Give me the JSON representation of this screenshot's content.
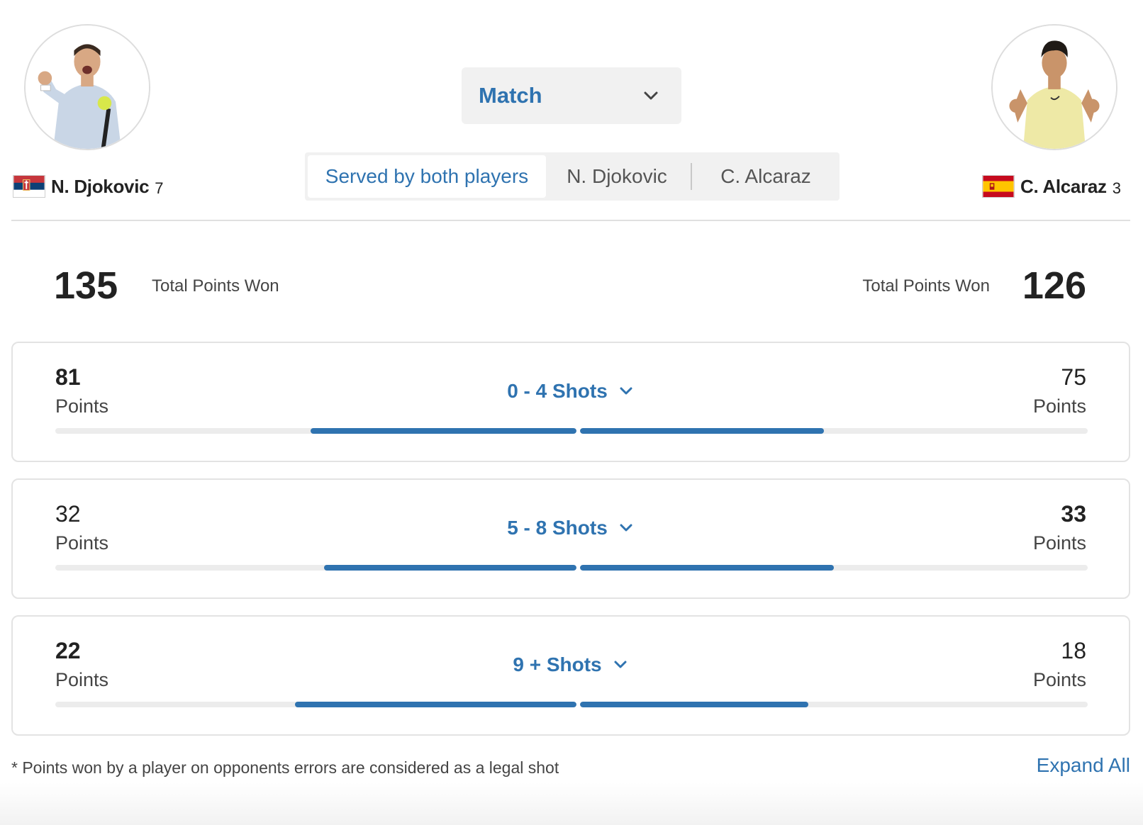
{
  "players": {
    "left": {
      "name": "N. Djokovic",
      "seed": "7",
      "flag": "serbia-flag",
      "total_points": "135",
      "total_label": "Total Points Won"
    },
    "right": {
      "name": "C. Alcaraz",
      "seed": "3",
      "flag": "spain-flag",
      "total_points": "126",
      "total_label": "Total Points Won"
    }
  },
  "period_select": {
    "value": "Match",
    "icon": "chevron-down-icon"
  },
  "serve_tabs": [
    {
      "label": "Served by both players",
      "active": true
    },
    {
      "label": "N. Djokovic",
      "active": false
    },
    {
      "label": "C. Alcaraz",
      "active": false
    }
  ],
  "rally_stats": [
    {
      "title": "0 - 4 Shots",
      "left": {
        "value": "81",
        "label": "Points",
        "bold": true,
        "bar_fraction": 0.51
      },
      "right": {
        "value": "75",
        "label": "Points",
        "bold": false,
        "bar_fraction": 0.48
      }
    },
    {
      "title": "5 - 8 Shots",
      "left": {
        "value": "32",
        "label": "Points",
        "bold": false,
        "bar_fraction": 0.485
      },
      "right": {
        "value": "33",
        "label": "Points",
        "bold": true,
        "bar_fraction": 0.5
      }
    },
    {
      "title": "9 + Shots",
      "left": {
        "value": "22",
        "label": "Points",
        "bold": true,
        "bar_fraction": 0.54
      },
      "right": {
        "value": "18",
        "label": "Points",
        "bold": false,
        "bar_fraction": 0.45
      }
    }
  ],
  "footnote": "* Points won by a player on opponents errors are considered as a legal shot",
  "expand_all": "Expand All",
  "colors": {
    "accent": "#2f73b0",
    "track": "#ececec"
  }
}
